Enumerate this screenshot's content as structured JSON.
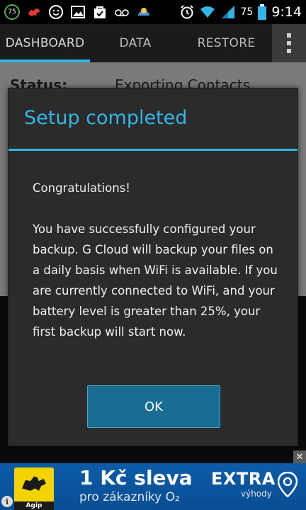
{
  "status_bar": {
    "notification_badge": "75",
    "battery_level": "75",
    "time": "9:14"
  },
  "tabs": [
    {
      "label": "DASHBOARD",
      "active": true
    },
    {
      "label": "DATA",
      "active": false
    },
    {
      "label": "RESTORE",
      "active": false
    }
  ],
  "background": {
    "status_label": "Status:",
    "status_value": "Exporting Contacts"
  },
  "dialog": {
    "title": "Setup completed",
    "greeting": "Congratulations!",
    "message": "You have successfully configured your backup. G Cloud will backup your files on a daily basis when WiFi is available. If you are currently connected to WiFi, and your battery level is greater than 25%, your first backup will start now.",
    "ok_label": "OK"
  },
  "ad": {
    "brand": "Agip",
    "headline": "1 Kč sleva",
    "subline": "pro zákazníky O₂",
    "extra": "EXTRA",
    "extra_sub": "výhody",
    "close_glyph": "✕",
    "info_glyph": "i"
  },
  "colors": {
    "accent": "#33b5e5",
    "dialog_bg": "#2b2b2b",
    "button_bg": "#1a6d92",
    "ad_bg": "#0a4d93",
    "agip_yellow": "#f3d200"
  }
}
